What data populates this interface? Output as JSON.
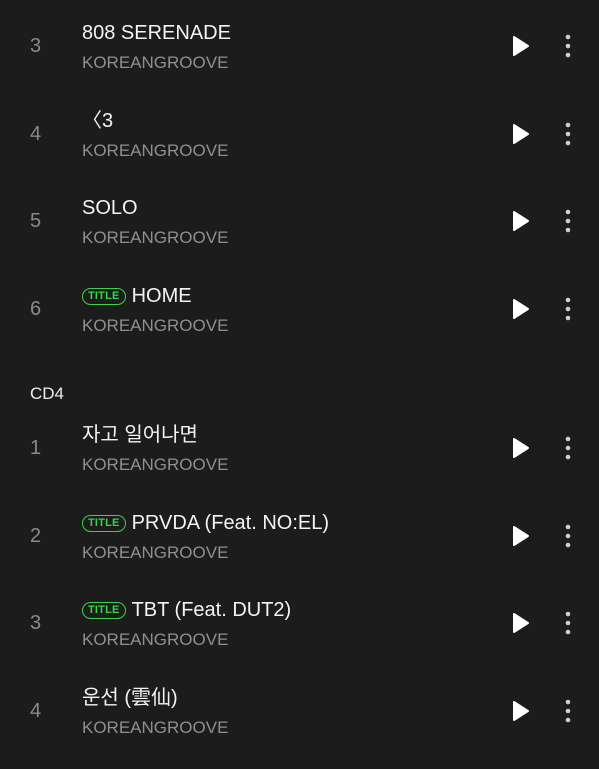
{
  "section": {
    "label": "CD4"
  },
  "tracks_top": [
    {
      "number": "3",
      "title": "808 SERENADE",
      "artist": "KOREANGROOVE",
      "is_title": false
    },
    {
      "number": "4",
      "title": "〈3",
      "artist": "KOREANGROOVE",
      "is_title": false
    },
    {
      "number": "5",
      "title": "SOLO",
      "artist": "KOREANGROOVE",
      "is_title": false
    },
    {
      "number": "6",
      "title": "HOME",
      "artist": "KOREANGROOVE",
      "is_title": true
    }
  ],
  "tracks_cd4": [
    {
      "number": "1",
      "title": "자고 일어나면",
      "artist": "KOREANGROOVE",
      "is_title": false
    },
    {
      "number": "2",
      "title": "PRVDA (Feat. NO:EL)",
      "artist": "KOREANGROOVE",
      "is_title": true
    },
    {
      "number": "3",
      "title": "TBT (Feat. DUT2)",
      "artist": "KOREANGROOVE",
      "is_title": true
    },
    {
      "number": "4",
      "title": "운선 (雲仙)",
      "artist": "KOREANGROOVE",
      "is_title": false
    }
  ],
  "badge": {
    "label": "TITLE"
  },
  "icons": {
    "play": "play-icon",
    "more": "more-vertical-icon"
  },
  "colors": {
    "background": "#1c1c1c",
    "accent": "#3bd14a",
    "muted": "#8f8f8f"
  }
}
